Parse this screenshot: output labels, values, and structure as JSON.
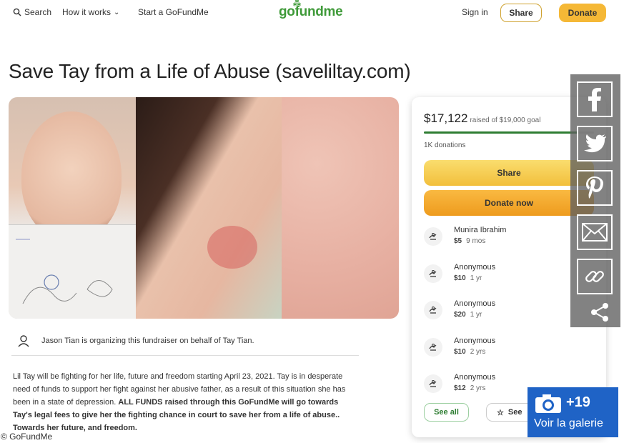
{
  "nav": {
    "search_label": "Search",
    "how_it_works_label": "How it works",
    "start_label": "Start a GoFundMe",
    "logo_text": "gofundme",
    "signin_label": "Sign in",
    "share_label": "Share",
    "donate_label": "Donate"
  },
  "page": {
    "title": "Save Tay from a Life of Abuse (saveliltay.com)"
  },
  "organizer": {
    "text": "Jason Tian is organizing this fundraiser on behalf of Tay Tian."
  },
  "story": {
    "text1": "Lil Tay will be fighting for her life, future and freedom starting April 23, 2021. Tay is in desperate need of funds to support her fight against her abusive father, as a result of this situation she has been in a state of depression. ",
    "bold": "ALL FUNDS raised through this GoFundMe will go towards Tay's legal fees to give her the fighting chance in court to save her from a life of abuse.. Towards her future, and freedom."
  },
  "donation_card": {
    "raised": "$17,122",
    "goal_text": "raised of $19,000 goal",
    "progress_fraction": 0.9,
    "donations_count": "1K donations",
    "share_label": "Share",
    "donate_now_label": "Donate now",
    "see_all_label": "See all",
    "see_top_label": "See",
    "donations": [
      {
        "name": "Munira Ibrahim",
        "amount": "$5",
        "ago": "9 mos"
      },
      {
        "name": "Anonymous",
        "amount": "$10",
        "ago": "1 yr"
      },
      {
        "name": "Anonymous",
        "amount": "$20",
        "ago": "1 yr"
      },
      {
        "name": "Anonymous",
        "amount": "$10",
        "ago": "2 yrs"
      },
      {
        "name": "Anonymous",
        "amount": "$12",
        "ago": "2 yrs"
      }
    ]
  },
  "share_rail": {
    "icons": [
      "facebook-icon",
      "twitter-icon",
      "pinterest-icon",
      "email-icon",
      "link-icon",
      "share-icon"
    ]
  },
  "gallery": {
    "count": "+19",
    "label": "Voir la galerie"
  },
  "credit": "© GoFundMe",
  "colors": {
    "brand_green": "#3f9a39",
    "donate_orange": "#f5b836",
    "gallery_blue": "#1f63c6"
  }
}
